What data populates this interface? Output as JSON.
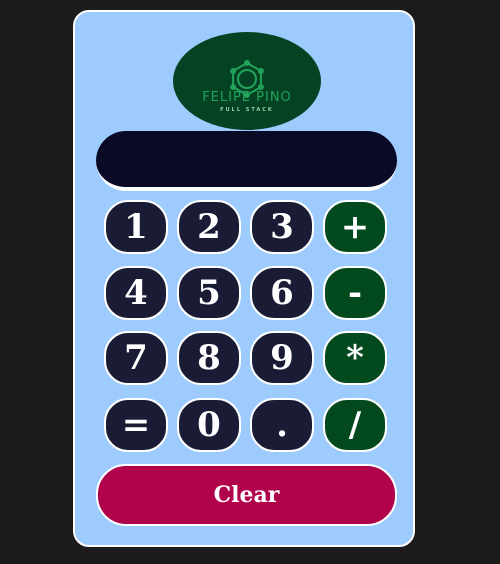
{
  "logo": {
    "title": "FELIPE PINO",
    "subtitle": "FULL STACK",
    "icon": "hexagon-nodes-icon",
    "bg_color": "#034222",
    "accent_color": "#21a35a"
  },
  "display": {
    "value": ""
  },
  "keys": {
    "row1": [
      "1",
      "2",
      "3",
      "+"
    ],
    "row2": [
      "4",
      "5",
      "6",
      "-"
    ],
    "row3": [
      "7",
      "8",
      "9",
      "*"
    ],
    "row4": [
      "=",
      "0",
      ".",
      "/"
    ]
  },
  "clear_label": "Clear",
  "colors": {
    "page_bg": "#1b1b1b",
    "panel_bg": "#9dcbfd",
    "display_bg": "#0a0a26",
    "digit_key_bg": "#1a1b35",
    "operator_key_bg": "#024a1d",
    "clear_bg": "#b0034b"
  }
}
